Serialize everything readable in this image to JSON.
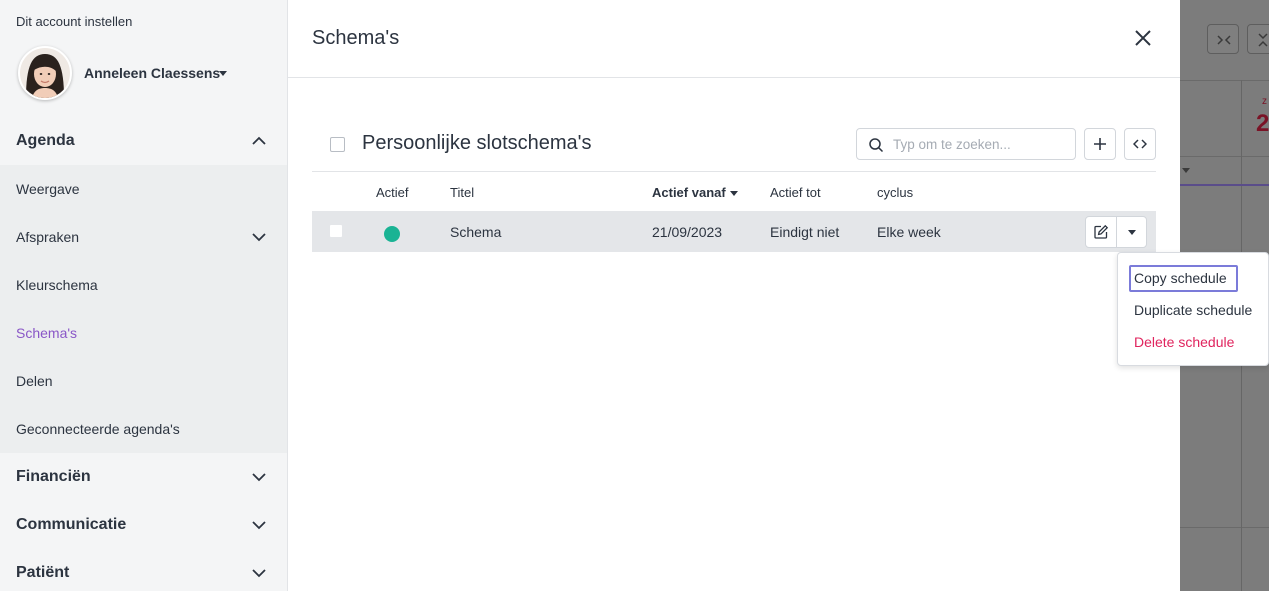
{
  "sidebar": {
    "account_title": "Dit account instellen",
    "user_name": "Anneleen Claessens",
    "sections": [
      {
        "label": "Agenda",
        "expanded": true
      },
      {
        "label": "Financiën",
        "expanded": false
      },
      {
        "label": "Communicatie",
        "expanded": false
      },
      {
        "label": "Patiënt",
        "expanded": false
      }
    ],
    "agenda_items": [
      {
        "label": "Weergave"
      },
      {
        "label": "Afspraken"
      },
      {
        "label": "Kleurschema"
      },
      {
        "label": "Schema's",
        "active": true
      },
      {
        "label": "Delen"
      },
      {
        "label": "Geconnecteerde agenda's"
      }
    ]
  },
  "modal": {
    "title": "Schema's",
    "close_icon": "close-icon",
    "panel_title": "Persoonlijke slotschema's",
    "search_placeholder": "Typ om te zoeken...",
    "add_icon": "plus-icon",
    "code_icon": "code-icon",
    "table": {
      "columns": [
        "Actief",
        "Titel",
        "Actief vanaf",
        "Actief tot",
        "cyclus"
      ],
      "sorted_column": "Actief vanaf",
      "rows": [
        {
          "active": true,
          "title": "Schema",
          "from": "21/09/2023",
          "to": "Eindigt niet",
          "cycle": "Elke week"
        }
      ]
    }
  },
  "row_menu": {
    "items": [
      "Copy schedule",
      "Duplicate schedule",
      "Delete schedule"
    ],
    "focused_item": "Copy schedule"
  },
  "background": {
    "day_letter": "z",
    "day_number": "2"
  },
  "colors": {
    "active_link": "#8a57c7",
    "active_dot": "#1ab394",
    "danger": "#e0245e",
    "focus_ring": "#7b7bd9"
  }
}
